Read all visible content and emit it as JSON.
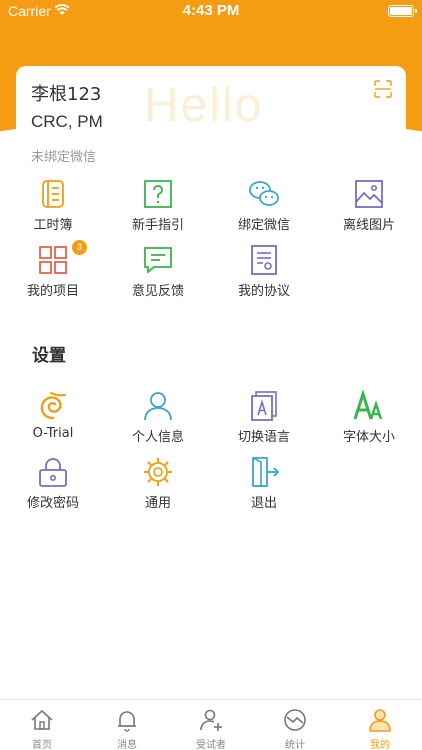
{
  "status_bar": {
    "carrier": "Carrier",
    "time": "4:43 PM"
  },
  "profile": {
    "watermark": "Hello",
    "name": "李根123",
    "role": "CRC, PM",
    "wechat_status": "未绑定微信"
  },
  "menu": {
    "workbook": "工时簿",
    "guide": "新手指引",
    "bind_wechat": "绑定微信",
    "offline_images": "离线图片",
    "my_projects": "我的项目",
    "my_projects_badge": "3",
    "feedback": "意见反馈",
    "my_agreement": "我的协议"
  },
  "settings": {
    "title": "设置",
    "otrial": "O-Trial",
    "personal_info": "个人信息",
    "switch_language": "切换语言",
    "font_size": "字体大小",
    "change_password": "修改密码",
    "general": "通用",
    "logout": "退出"
  },
  "tabs": {
    "home": "首页",
    "messages": "消息",
    "subjects": "受试者",
    "stats": "统计",
    "mine": "我的"
  },
  "colors": {
    "accent": "#F59C12",
    "purple": "#7B6BC9",
    "teal": "#3BA7C9",
    "green": "#3AB44A"
  }
}
